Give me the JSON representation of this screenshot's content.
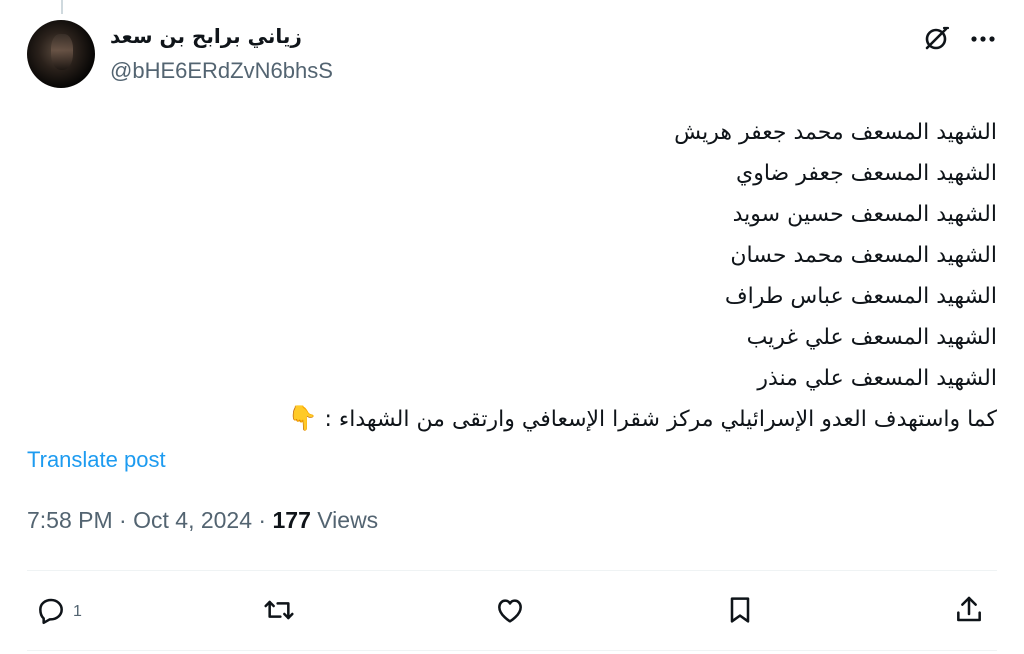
{
  "author": {
    "display_name": "زياني برابح بن سعد",
    "handle": "@bHE6ERdZvN6bhsS"
  },
  "header_icons": [
    "grok-icon",
    "more-icon"
  ],
  "tweet": {
    "lines": [
      "الشهيد المسعف محمد جعفر هريش",
      "الشهيد المسعف جعفر ضاوي",
      "الشهيد المسعف حسين سويد",
      "الشهيد المسعف محمد حسان",
      "الشهيد المسعف عباس طراف",
      "الشهيد المسعف علي غريب",
      "الشهيد المسعف علي منذر",
      "كما واستهدف العدو الإسرائيلي مركز شقرا  الإسعافي وارتقى من الشهداء :"
    ],
    "emoji": "👇"
  },
  "translate_label": "Translate post",
  "meta": {
    "time": "7:58 PM",
    "separator1": " · ",
    "date": "Oct 4, 2024",
    "separator2": " · ",
    "views_count": "177",
    "views_label": " Views"
  },
  "actions": {
    "reply_count": "1",
    "icons": [
      "reply-icon",
      "retweet-icon",
      "like-icon",
      "bookmark-icon",
      "share-icon"
    ]
  },
  "colors": {
    "accent": "#1d9bf0",
    "secondary_text": "#536471",
    "primary_text": "#0f1419",
    "divider": "#eff3f4"
  }
}
